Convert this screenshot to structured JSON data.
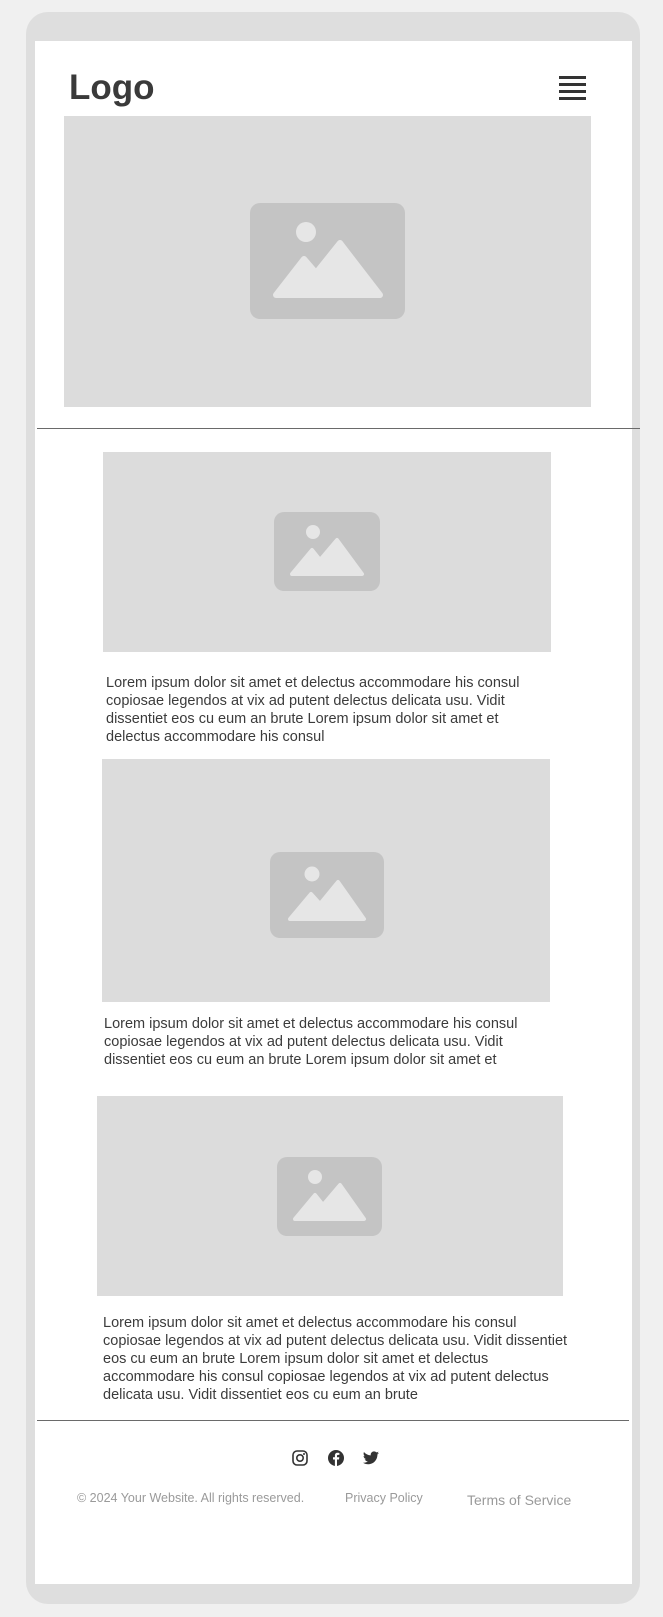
{
  "header": {
    "logo": "Logo",
    "menu_icon": "hamburger-menu-icon"
  },
  "hero": {
    "image_icon": "image-placeholder-icon"
  },
  "cards": [
    {
      "text": "Lorem ipsum dolor sit amet et delectus accommodare his consul copiosae legendos at vix ad putent delectus delicata usu. Vidit dissentiet eos cu eum an brute Lorem ipsum dolor sit amet et delectus accommodare his consul"
    },
    {
      "text": "Lorem ipsum dolor sit amet et delectus accommodare his consul copiosae legendos at vix ad putent delectus delicata usu. Vidit dissentiet eos cu eum an brute Lorem ipsum dolor sit amet et"
    },
    {
      "text": "Lorem ipsum dolor sit amet et delectus accommodare his consul copiosae legendos at vix ad putent delectus delicata usu. Vidit dissentiet eos cu eum an brute Lorem ipsum dolor sit amet et delectus accommodare his consul copiosae legendos at vix ad putent delectus delicata usu. Vidit dissentiet eos cu eum an brute"
    }
  ],
  "footer": {
    "social_icons": [
      "instagram-icon",
      "facebook-icon",
      "twitter-icon"
    ],
    "copyright": "© 2024 Your Website. All rights reserved.",
    "privacy": "Privacy Policy",
    "terms": "Terms of Service"
  },
  "colors": {
    "placeholder_bg": "#dcdcdc",
    "placeholder_icon": "#c4c4c4",
    "text": "#3b3b3b",
    "footer_text": "#9a9a9a"
  }
}
